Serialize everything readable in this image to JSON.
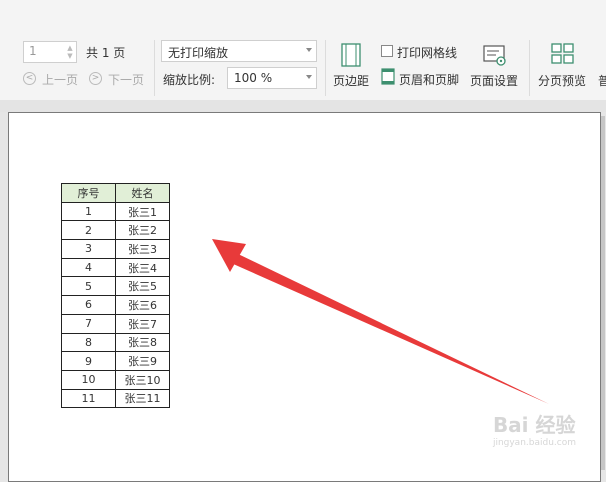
{
  "toolbar": {
    "page_number_value": "1",
    "total_pages_label": "共 1 页",
    "prev_page_label": "上一页",
    "next_page_label": "下一页",
    "print_scale_option": "无打印缩放",
    "zoom_label": "缩放比例:",
    "zoom_value": "100 %",
    "margin_label": "页边距",
    "print_gridlines_label": "打印网格线",
    "header_footer_label": "页眉和页脚",
    "page_setup_label": "页面设置",
    "page_break_preview_label": "分页预览",
    "cut_off_label": "普"
  },
  "sheet": {
    "headers": [
      "序号",
      "姓名"
    ],
    "rows": [
      [
        "1",
        "张三1"
      ],
      [
        "2",
        "张三2"
      ],
      [
        "3",
        "张三3"
      ],
      [
        "4",
        "张三4"
      ],
      [
        "5",
        "张三5"
      ],
      [
        "6",
        "张三6"
      ],
      [
        "7",
        "张三7"
      ],
      [
        "8",
        "张三8"
      ],
      [
        "9",
        "张三9"
      ],
      [
        "10",
        "张三10"
      ],
      [
        "11",
        "张三11"
      ]
    ]
  },
  "annotation": {
    "arrow_color": "#e83a3a"
  },
  "watermark": {
    "text": "Bai 经验",
    "subtext": "jingyan.baidu.com"
  }
}
